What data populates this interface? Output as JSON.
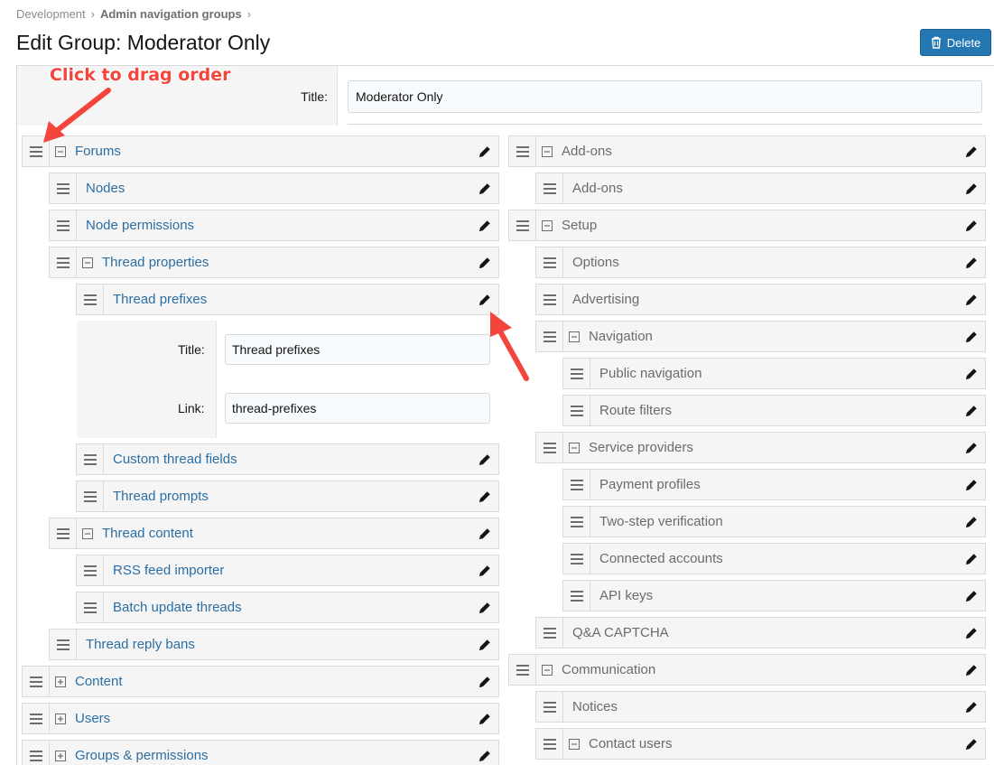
{
  "breadcrumb": {
    "items": [
      "Development",
      "Admin navigation groups"
    ],
    "sep": "›"
  },
  "page_title": "Edit Group: Moderator Only",
  "delete_label": "Delete",
  "title_label": "Title:",
  "title_value": "Moderator Only",
  "annotation": "Click to drag order",
  "left_rows": [
    {
      "label": "Forums",
      "toggle": "minus"
    },
    {
      "label": "Nodes"
    },
    {
      "label": "Node permissions"
    },
    {
      "label": "Thread properties",
      "toggle": "minus"
    },
    {
      "label": "Thread prefixes"
    },
    {
      "label": "Custom thread fields"
    },
    {
      "label": "Thread prompts"
    },
    {
      "label": "Thread content",
      "toggle": "minus"
    },
    {
      "label": "RSS feed importer"
    },
    {
      "label": "Batch update threads"
    },
    {
      "label": "Thread reply bans"
    },
    {
      "label": "Content",
      "toggle": "plus"
    },
    {
      "label": "Users",
      "toggle": "plus"
    },
    {
      "label": "Groups & permissions",
      "toggle": "plus"
    }
  ],
  "edit_form": {
    "title_label": "Title:",
    "title_value": "Thread prefixes",
    "link_label": "Link:",
    "link_value": "thread-prefixes"
  },
  "right_rows": [
    {
      "label": "Add-ons",
      "toggle": "minus"
    },
    {
      "label": "Add-ons"
    },
    {
      "label": "Setup",
      "toggle": "minus"
    },
    {
      "label": "Options"
    },
    {
      "label": "Advertising"
    },
    {
      "label": "Navigation",
      "toggle": "minus"
    },
    {
      "label": "Public navigation"
    },
    {
      "label": "Route filters"
    },
    {
      "label": "Service providers",
      "toggle": "minus"
    },
    {
      "label": "Payment profiles"
    },
    {
      "label": "Two-step verification"
    },
    {
      "label": "Connected accounts"
    },
    {
      "label": "API keys"
    },
    {
      "label": "Q&A CAPTCHA"
    },
    {
      "label": "Communication",
      "toggle": "minus"
    },
    {
      "label": "Notices"
    },
    {
      "label": "Contact users",
      "toggle": "minus"
    }
  ],
  "colors": {
    "accent": "#2577b1",
    "link": "#2b6ea3",
    "annotation": "#f4453d"
  },
  "icons": [
    "drag-handle-icon",
    "collapse-icon",
    "expand-icon",
    "pencil-icon",
    "trash-icon"
  ]
}
